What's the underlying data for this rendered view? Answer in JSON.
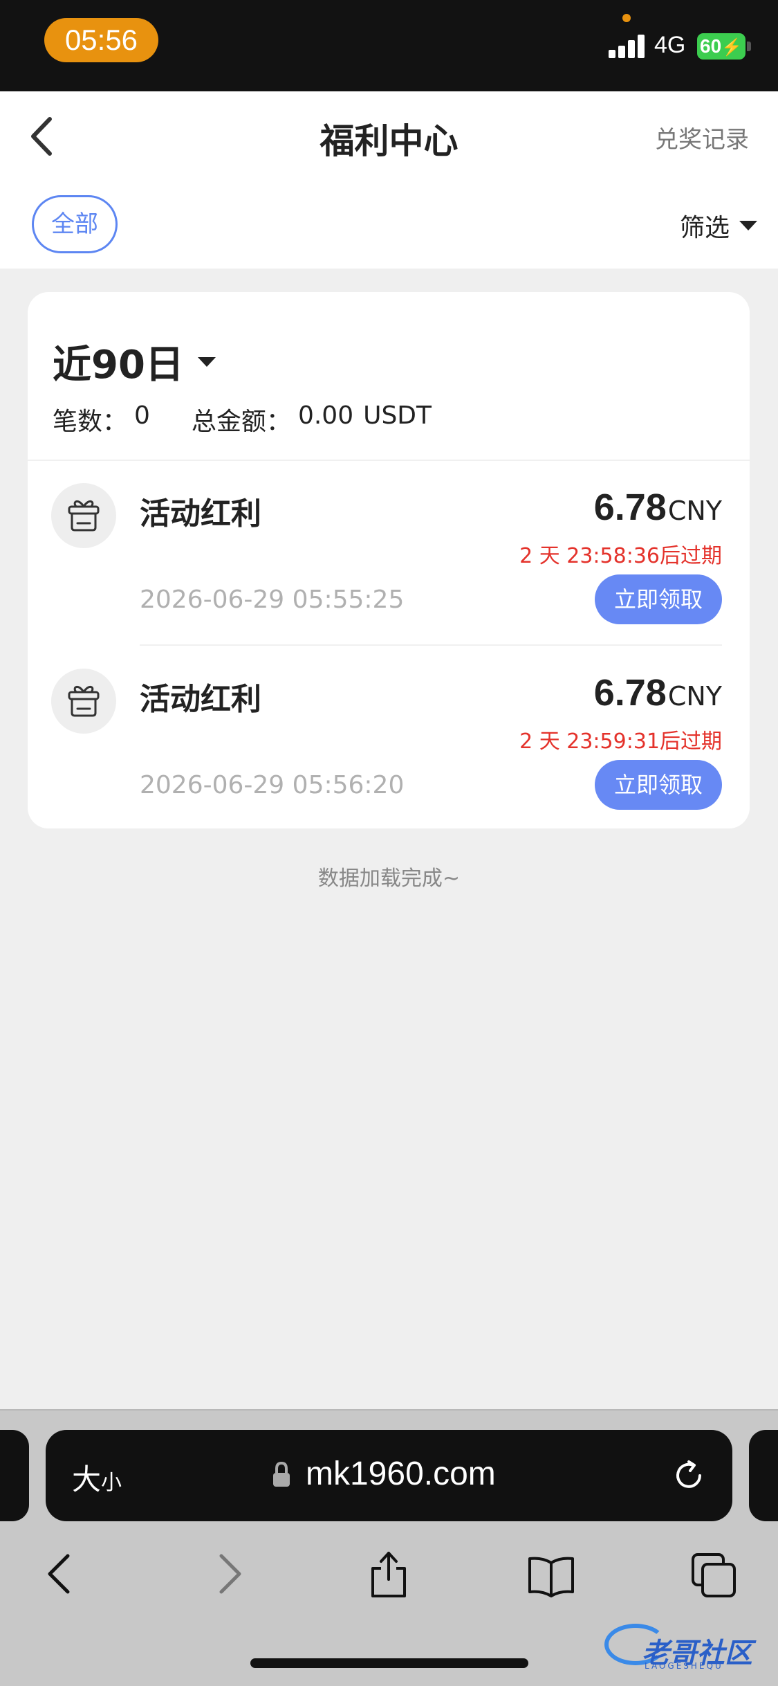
{
  "status_bar": {
    "time": "05:56",
    "network": "4G",
    "battery": "60"
  },
  "header": {
    "title": "福利中心",
    "records_link": "兑奖记录",
    "chip_all": "全部",
    "filter_label": "筛选"
  },
  "summary": {
    "period": "近90日",
    "count_label": "笔数：",
    "count_value": "0",
    "total_label": "总金额：",
    "total_value": "0.00",
    "total_currency": "USDT"
  },
  "items": [
    {
      "title": "活动红利",
      "date": "2026-06-29 05:55:25",
      "amount": "6.78",
      "currency": "CNY",
      "expiry": "2 天 23:58:36后过期",
      "action": "立即领取"
    },
    {
      "title": "活动红利",
      "date": "2026-06-29 05:56:20",
      "amount": "6.78",
      "currency": "CNY",
      "expiry": "2 天 23:59:31后过期",
      "action": "立即领取"
    }
  ],
  "load_complete": "数据加载完成~",
  "browser": {
    "text_size_big": "大",
    "text_size_small": "小",
    "url": "mk1960.com"
  },
  "watermark": {
    "text": "老哥社区",
    "sub": "LAOGESHEQU"
  },
  "colors": {
    "accent": "#6789f4",
    "chip_border": "#5d86f2",
    "expiry": "#e4322b",
    "time_pill": "#e8920f",
    "battery": "#3ccd4f"
  }
}
